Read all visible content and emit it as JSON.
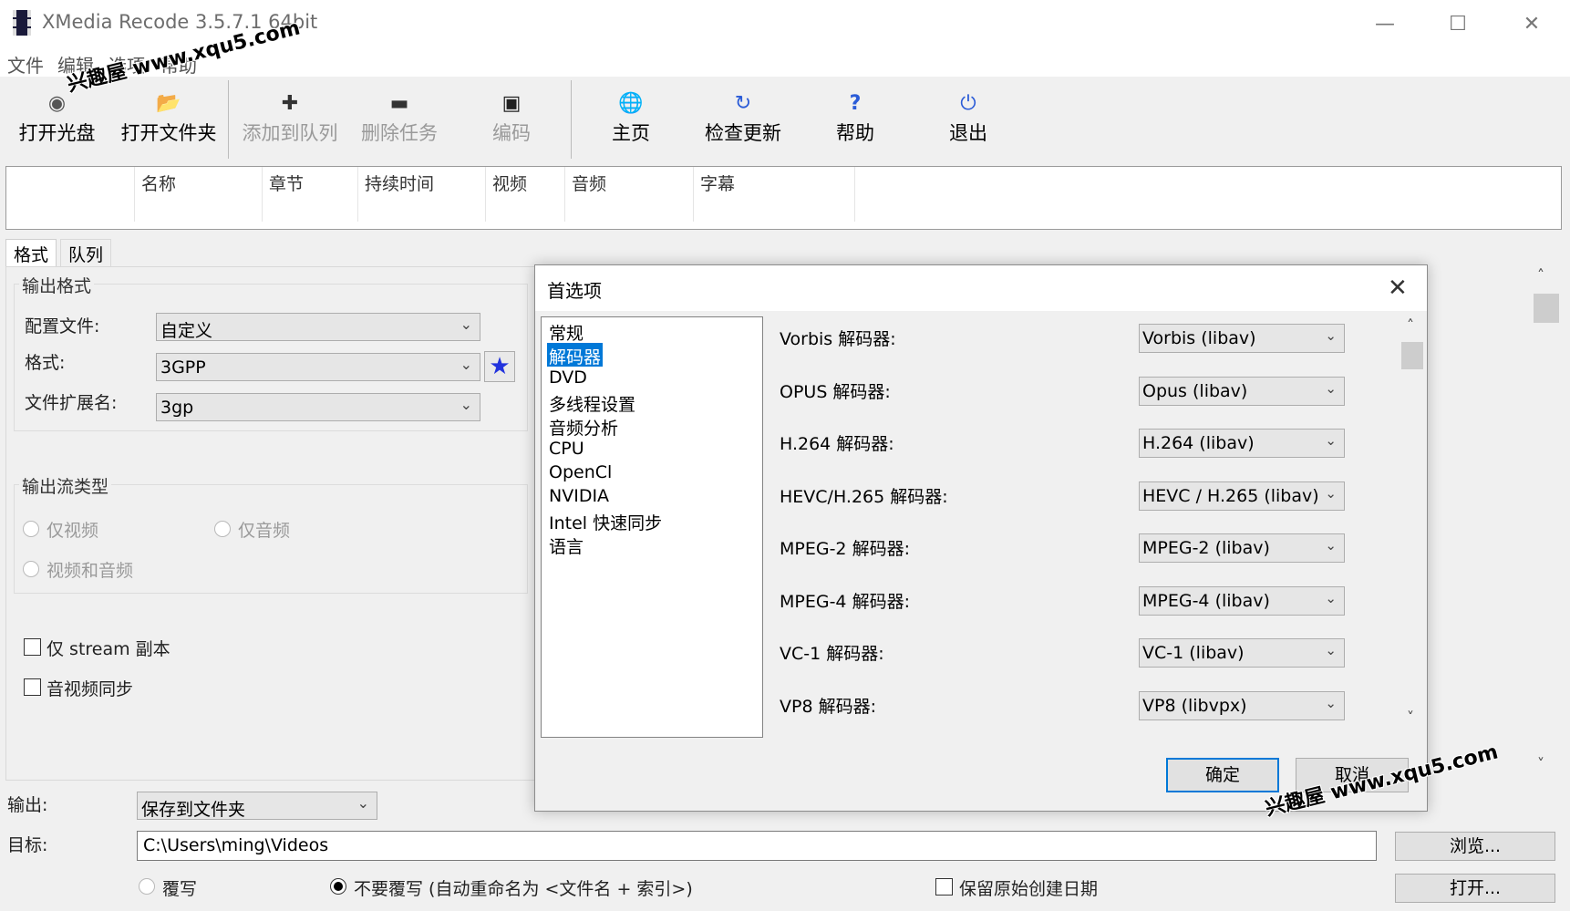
{
  "window": {
    "title": "XMedia Recode 3.5.7.1 64bit",
    "minimize_icon": "minimize-icon",
    "maximize_icon": "maximize-icon",
    "close_icon": "close-icon"
  },
  "menu": [
    "文件",
    "编辑",
    "选项",
    "帮助"
  ],
  "toolbar": {
    "items": [
      {
        "label": "打开光盘",
        "icon": "disc-icon",
        "enabled": true
      },
      {
        "label": "打开文件夹",
        "icon": "folder-icon",
        "enabled": true
      },
      {
        "label": "添加到队列",
        "icon": "plus-icon",
        "enabled": false
      },
      {
        "label": "删除任务",
        "icon": "minus-icon",
        "enabled": false
      },
      {
        "label": "编码",
        "icon": "encode-icon",
        "enabled": false
      },
      {
        "label": "主页",
        "icon": "globe-icon",
        "enabled": true
      },
      {
        "label": "检查更新",
        "icon": "refresh-icon",
        "enabled": true
      },
      {
        "label": "帮助",
        "icon": "help-icon",
        "enabled": true
      },
      {
        "label": "退出",
        "icon": "power-icon",
        "enabled": true
      }
    ]
  },
  "file_list": {
    "columns": [
      "名称",
      "章节",
      "持续时间",
      "视频",
      "音频",
      "字幕"
    ]
  },
  "tabs": [
    "格式",
    "队列"
  ],
  "format_panel": {
    "output_format_title": "输出格式",
    "profile_label": "配置文件:",
    "profile_value": "自定义",
    "format_label": "格式:",
    "format_value": "3GPP",
    "ext_label": "文件扩展名:",
    "ext_value": "3gp",
    "stream_type_title": "输出流类型",
    "video_only": "仅视频",
    "audio_only": "仅音频",
    "video_and_audio": "视频和音频",
    "stream_copy_label": "仅 stream 副本",
    "av_sync_label": "音视频同步"
  },
  "bottom": {
    "output_label": "输出:",
    "output_value": "保存到文件夹",
    "target_label": "目标:",
    "target_value": "C:\\Users\\ming\\Videos",
    "browse_button": "浏览...",
    "open_button": "打开...",
    "overwrite_label": "覆写",
    "no_overwrite_label": "不要覆写 (自动重命名为 <文件名 + 索引>)",
    "keep_date_label": "保留原始创建日期"
  },
  "dialog": {
    "title": "首选项",
    "categories": [
      "常规",
      "解码器",
      "DVD",
      "多线程设置",
      "音频分析",
      "CPU",
      "OpenCl",
      "NVIDIA",
      "Intel 快速同步",
      "语言"
    ],
    "selected_category": "解码器",
    "decoders": [
      {
        "label": "Vorbis 解码器:",
        "value": "Vorbis (libav)"
      },
      {
        "label": "OPUS 解码器:",
        "value": "Opus (libav)"
      },
      {
        "label": "H.264 解码器:",
        "value": "H.264 (libav)"
      },
      {
        "label": "HEVC/H.265 解码器:",
        "value": "HEVC / H.265 (libav)"
      },
      {
        "label": "MPEG-2 解码器:",
        "value": "MPEG-2 (libav)"
      },
      {
        "label": "MPEG-4 解码器:",
        "value": "MPEG-4 (libav)"
      },
      {
        "label": "VC-1 解码器:",
        "value": "VC-1 (libav)"
      },
      {
        "label": "VP8 解码器:",
        "value": "VP8 (libvpx)"
      }
    ],
    "ok_button": "确定",
    "cancel_button": "取消"
  },
  "watermark": {
    "text1": "兴趣屋 www.xqu5.com",
    "text2": "兴趣屋 www.xqu5.com"
  },
  "colors": {
    "selection": "#0078d7",
    "star": "#2233dd"
  }
}
